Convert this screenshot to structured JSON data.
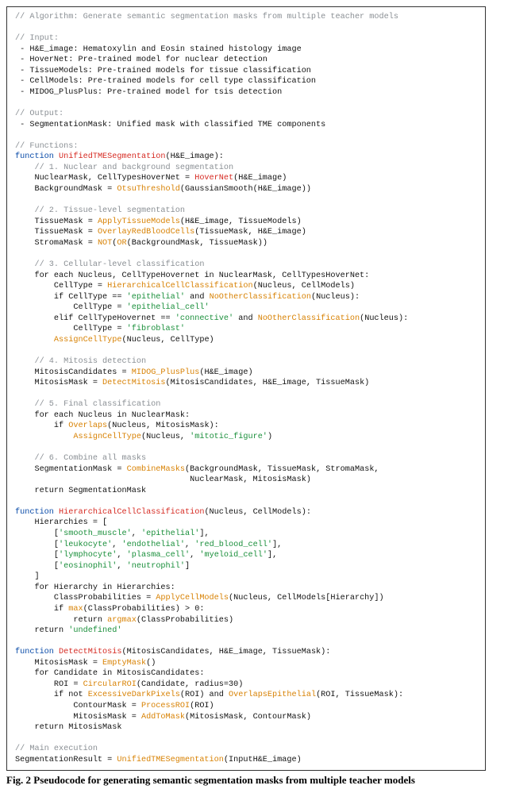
{
  "caption": "Fig. 2 Pseudocode for generating semantic segmentation masks from multiple teacher models",
  "l": {
    "l01": "// Algorithm: Generate semantic segmentation masks from multiple teacher models",
    "l03": "// Input:",
    "l04": " - H&E_image: Hematoxylin and Eosin stained histology image",
    "l05": " - HoverNet: Pre-trained model for nuclear detection",
    "l06": " - TissueModels: Pre-trained models for tissue classification",
    "l07": " - CellModels: Pre-trained models for cell type classification",
    "l08": " - MIDOG_PlusPlus: Pre-trained model for tsis detection",
    "l10": "// Output:",
    "l11": " - SegmentationMask: Unified mask with classified TME components",
    "l13": "// Functions:",
    "l14a": "function ",
    "l14b": "UnifiedTMESegmentation",
    "l14c": "(H&E_image):",
    "l15": "    // 1. Nuclear and background segmentation",
    "l16a": "    NuclearMask, CellTypesHoverNet = ",
    "l16b": "HoverNet",
    "l16c": "(H&E_image)",
    "l17a": "    BackgroundMask = ",
    "l17b": "OtsuThreshold",
    "l17c": "(GaussianSmooth(H&E_image))",
    "l19": "    // 2. Tissue-level segmentation",
    "l20a": "    TissueMask = ",
    "l20b": "ApplyTissueModels",
    "l20c": "(H&E_image, TissueModels)",
    "l21a": "    TissueMask = ",
    "l21b": "OverlayRedBloodCells",
    "l21c": "(TissueMask, H&E_image)",
    "l22a": "    StromaMask = ",
    "l22b": "NOT",
    "l22c": "(",
    "l22d": "OR",
    "l22e": "(BackgroundMask, TissueMask))",
    "l24": "    // 3. Cellular-level classification",
    "l25a": "    for each Nucleus, CellTypeHovernet in NuclearMask, CellTypesHoverNet:",
    "l26a": "        CellType = ",
    "l26b": "HierarchicalCellClassification",
    "l26c": "(Nucleus, CellModels)",
    "l27a": "        if CellType == ",
    "l27b": "'epithelial'",
    "l27c": " and ",
    "l27d": "NoOtherClassification",
    "l27e": "(Nucleus):",
    "l28a": "            CellType = ",
    "l28b": "'epithelial_cell'",
    "l29a": "        elif CellTypeHovernet == ",
    "l29b": "'connective'",
    "l29c": " and ",
    "l29d": "NoOtherClassification",
    "l29e": "(Nucleus):",
    "l30a": "            CellType = ",
    "l30b": "'fibroblast'",
    "l31a": "        ",
    "l31b": "AssignCellType",
    "l31c": "(Nucleus, CellType)",
    "l33": "    // 4. Mitosis detection",
    "l34a": "    MitosisCandidates = ",
    "l34b": "MIDOG_PlusPlus",
    "l34c": "(H&E_image)",
    "l35a": "    MitosisMask = ",
    "l35b": "DetectMitosis",
    "l35c": "(MitosisCandidates, H&E_image, TissueMask)",
    "l37": "    // 5. Final classification",
    "l38": "    for each Nucleus in NuclearMask:",
    "l39a": "        if ",
    "l39b": "Overlaps",
    "l39c": "(Nucleus, MitosisMask):",
    "l40a": "            ",
    "l40b": "AssignCellType",
    "l40c": "(Nucleus, ",
    "l40d": "'mitotic_figure'",
    "l40e": ")",
    "l42": "    // 6. Combine all masks",
    "l43a": "    SegmentationMask = ",
    "l43b": "CombineMasks",
    "l43c": "(BackgroundMask, TissueMask, StromaMask,",
    "l44": "                                    NuclearMask, MitosisMask)",
    "l45": "    return SegmentationMask",
    "l47a": "function ",
    "l47b": "HierarchicalCellClassification",
    "l47c": "(Nucleus, CellModels):",
    "l48": "    Hierarchies = [",
    "l49a": "        [",
    "l49b": "'smooth_muscle'",
    "l49c": ", ",
    "l49d": "'epithelial'",
    "l49e": "],",
    "l50a": "        [",
    "l50b": "'leukocyte'",
    "l50c": ", ",
    "l50d": "'endothelial'",
    "l50e": ", ",
    "l50f": "'red_blood_cell'",
    "l50g": "],",
    "l51a": "        [",
    "l51b": "'lymphocyte'",
    "l51c": ", ",
    "l51d": "'plasma_cell'",
    "l51e": ", ",
    "l51f": "'myeloid_cell'",
    "l51g": "],",
    "l52a": "        [",
    "l52b": "'eosinophil'",
    "l52c": ", ",
    "l52d": "'neutrophil'",
    "l52e": "]",
    "l53": "    ]",
    "l54": "    for Hierarchy in Hierarchies:",
    "l55a": "        ClassProbabilities = ",
    "l55b": "ApplyCellModels",
    "l55c": "(Nucleus, CellModels[Hierarchy])",
    "l56a": "        if ",
    "l56b": "max",
    "l56c": "(ClassProbabilities) > 0:",
    "l57a": "            return ",
    "l57b": "argmax",
    "l57c": "(ClassProbabilities)",
    "l58a": "    return ",
    "l58b": "'undefined'",
    "l60a": "function ",
    "l60b": "DetectMitosis",
    "l60c": "(MitosisCandidates, H&E_image, TissueMask):",
    "l61a": "    MitosisMask = ",
    "l61b": "EmptyMask",
    "l61c": "()",
    "l62": "    for Candidate in MitosisCandidates:",
    "l63a": "        ROI = ",
    "l63b": "CircularROI",
    "l63c": "(Candidate, radius=30)",
    "l64a": "        if not ",
    "l64b": "ExcessiveDarkPixels",
    "l64c": "(ROI) and ",
    "l64d": "OverlapsEpithelial",
    "l64e": "(ROI, TissueMask):",
    "l65a": "            ContourMask = ",
    "l65b": "ProcessROI",
    "l65c": "(ROI)",
    "l66a": "            MitosisMask = ",
    "l66b": "AddToMask",
    "l66c": "(MitosisMask, ContourMask)",
    "l67": "    return MitosisMask",
    "l69": "// Main execution",
    "l70a": "SegmentationResult = ",
    "l70b": "UnifiedTMESegmentation",
    "l70c": "(InputH&E_image)"
  }
}
